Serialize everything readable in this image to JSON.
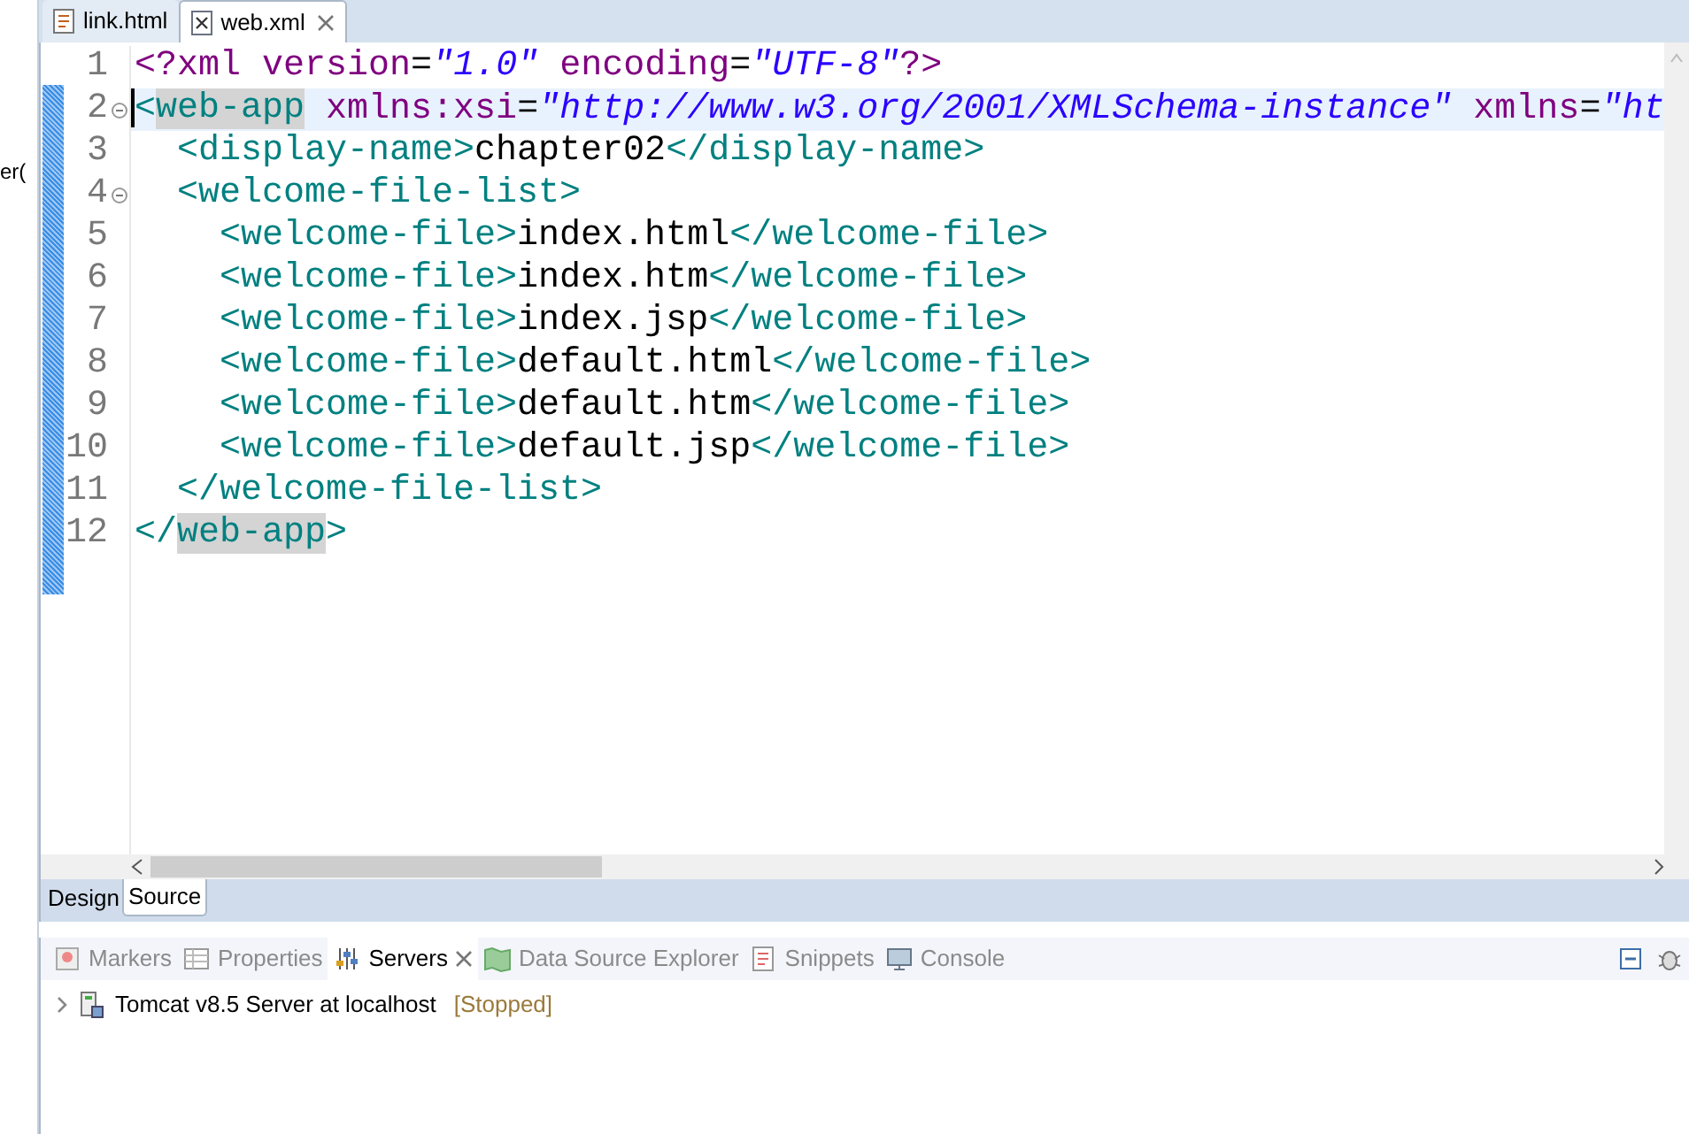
{
  "side_panel": {
    "text": "er("
  },
  "editor_tabs": [
    {
      "label": "link.html",
      "kind": "html",
      "selected": false,
      "closable": false
    },
    {
      "label": "web.xml",
      "kind": "xml",
      "selected": true,
      "closable": true
    }
  ],
  "code_lines": [
    {
      "number": "1",
      "current": false,
      "foldable": false,
      "tokens": [
        {
          "kind": "pi",
          "text": "<?"
        },
        {
          "kind": "attr",
          "text": "xml version"
        },
        {
          "kind": "eq",
          "text": "="
        },
        {
          "kind": "value",
          "text": "\"1.0\""
        },
        {
          "kind": "attr",
          "text": " encoding"
        },
        {
          "kind": "eq",
          "text": "="
        },
        {
          "kind": "value",
          "text": "\"UTF-8\""
        },
        {
          "kind": "pi",
          "text": "?>"
        }
      ]
    },
    {
      "number": "2",
      "current": true,
      "foldable": true,
      "tokens": [
        {
          "kind": "tag",
          "text": "<"
        },
        {
          "kind": "match",
          "text": "web-app"
        },
        {
          "kind": "attr",
          "text": " xmlns:xsi"
        },
        {
          "kind": "eq",
          "text": "="
        },
        {
          "kind": "value",
          "text": "\"http://www.w3.org/2001/XMLSchema-instance\""
        },
        {
          "kind": "attr",
          "text": " xmlns"
        },
        {
          "kind": "eq",
          "text": "="
        },
        {
          "kind": "value",
          "text": "\"ht"
        }
      ]
    },
    {
      "number": "3",
      "current": false,
      "foldable": false,
      "tokens": [
        {
          "kind": "tag",
          "text": "  <display-name>"
        },
        {
          "kind": "text",
          "text": "chapter02"
        },
        {
          "kind": "tag",
          "text": "</display-name>"
        }
      ]
    },
    {
      "number": "4",
      "current": false,
      "foldable": true,
      "tokens": [
        {
          "kind": "tag",
          "text": "  <welcome-file-list>"
        }
      ]
    },
    {
      "number": "5",
      "current": false,
      "foldable": false,
      "tokens": [
        {
          "kind": "tag",
          "text": "    <welcome-file>"
        },
        {
          "kind": "text",
          "text": "index.html"
        },
        {
          "kind": "tag",
          "text": "</welcome-file>"
        }
      ]
    },
    {
      "number": "6",
      "current": false,
      "foldable": false,
      "tokens": [
        {
          "kind": "tag",
          "text": "    <welcome-file>"
        },
        {
          "kind": "text",
          "text": "index.htm"
        },
        {
          "kind": "tag",
          "text": "</welcome-file>"
        }
      ]
    },
    {
      "number": "7",
      "current": false,
      "foldable": false,
      "tokens": [
        {
          "kind": "tag",
          "text": "    <welcome-file>"
        },
        {
          "kind": "text",
          "text": "index.jsp"
        },
        {
          "kind": "tag",
          "text": "</welcome-file>"
        }
      ]
    },
    {
      "number": "8",
      "current": false,
      "foldable": false,
      "tokens": [
        {
          "kind": "tag",
          "text": "    <welcome-file>"
        },
        {
          "kind": "text",
          "text": "default.html"
        },
        {
          "kind": "tag",
          "text": "</welcome-file>"
        }
      ]
    },
    {
      "number": "9",
      "current": false,
      "foldable": false,
      "tokens": [
        {
          "kind": "tag",
          "text": "    <welcome-file>"
        },
        {
          "kind": "text",
          "text": "default.htm"
        },
        {
          "kind": "tag",
          "text": "</welcome-file>"
        }
      ]
    },
    {
      "number": "10",
      "current": false,
      "foldable": false,
      "tokens": [
        {
          "kind": "tag",
          "text": "    <welcome-file>"
        },
        {
          "kind": "text",
          "text": "default.jsp"
        },
        {
          "kind": "tag",
          "text": "</welcome-file>"
        }
      ]
    },
    {
      "number": "11",
      "current": false,
      "foldable": false,
      "tokens": [
        {
          "kind": "tag",
          "text": "  </welcome-file-list>"
        }
      ]
    },
    {
      "number": "12",
      "current": false,
      "foldable": false,
      "tokens": [
        {
          "kind": "tag",
          "text": "</"
        },
        {
          "kind": "match",
          "text": "web-app"
        },
        {
          "kind": "tag",
          "text": ">"
        }
      ]
    }
  ],
  "page_tabs": [
    {
      "label": "Design",
      "selected": false
    },
    {
      "label": "Source",
      "selected": true
    }
  ],
  "view_tabs": [
    {
      "label": "Markers",
      "kind": "markers",
      "selected": false
    },
    {
      "label": "Properties",
      "kind": "properties",
      "selected": false
    },
    {
      "label": "Servers",
      "kind": "servers",
      "selected": true
    },
    {
      "label": "Data Source Explorer",
      "kind": "datasource",
      "selected": false
    },
    {
      "label": "Snippets",
      "kind": "snippets",
      "selected": false
    },
    {
      "label": "Console",
      "kind": "console",
      "selected": false
    }
  ],
  "servers": [
    {
      "name": "Tomcat v8.5 Server at localhost",
      "status": "[Stopped]",
      "expanded": false
    }
  ]
}
